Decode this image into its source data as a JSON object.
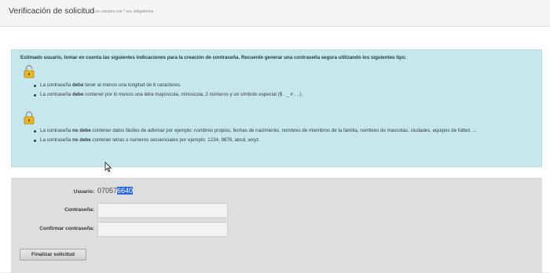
{
  "header": {
    "title": "Verificación de solicitud",
    "subtitle": "Los campos con * son obligatorios"
  },
  "info": {
    "intro": "Estimado usuario, tomar en cuenta las siguientes indicaciones para la creación de contraseña. Recuerde generar una contraseña segura utilizando los siguientes tips:",
    "must_icon": "lock-open-icon",
    "must_not_icon": "lock-icon",
    "must_items": [
      {
        "pre": "La contraseña ",
        "strong": "debe",
        "post": " tener al menos una longitud de 8 caracteres."
      },
      {
        "pre": "La contraseña ",
        "strong": "debe",
        "post": " contener por lo menos una letra mayúscula, minúscula, 2 números y un símbolo especial ($ . _ # . ..)."
      }
    ],
    "must_not_items": [
      {
        "pre": "La contraseña ",
        "strong": "no debe",
        "post": " contener datos fáciles de adivinar por ejemplo: nombres propios, fechas de nacimiento, nombres de miembros de la familia, nombres de mascotas, ciudades, equipos de fútbol. ..."
      },
      {
        "pre": "La contraseña ",
        "strong": "no debe",
        "post": " contener letras o números secuenciales por ejemplo: 1234, 9876, abcd, wxyz."
      }
    ]
  },
  "form": {
    "user_label": "Usuario:",
    "user_value_plain": "07057",
    "user_value_selected": "6640",
    "password_label": "Contraseña:",
    "password_value": "",
    "confirm_label": "Confirmar contraseña:",
    "confirm_value": "",
    "submit_label": "Finalizar solicitud"
  }
}
